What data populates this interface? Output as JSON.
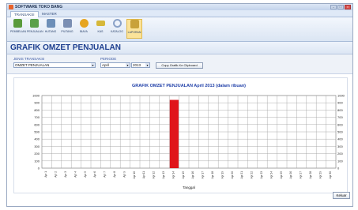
{
  "window": {
    "title": "SOFTWARE TOKO BANG"
  },
  "ribbon_tabs": [
    {
      "label": "TRANSAKSI",
      "active": true
    },
    {
      "label": "MASTER",
      "active": false
    }
  ],
  "ribbon_buttons": [
    {
      "label": "PEMBELIAN",
      "icon": "cart-icon",
      "color": "#5a9b3c"
    },
    {
      "label": "PENJUALAN",
      "icon": "money-icon",
      "color": "#5aa04a"
    },
    {
      "label": "HUTANG",
      "icon": "ledger-icon",
      "color": "#6d8fb8"
    },
    {
      "label": "PIUTANG",
      "icon": "notes-icon",
      "color": "#7b8fb3"
    },
    {
      "label": "BIAYA",
      "icon": "coin-icon",
      "color": "#e6a521"
    },
    {
      "label": "KAS",
      "icon": "cash-icon",
      "color": "#d6b83a"
    },
    {
      "label": "KATALOG",
      "icon": "magnifier-icon",
      "color": "#8aa2c8"
    },
    {
      "label": "LAPORAN",
      "icon": "report-icon",
      "color": "#c9a23a",
      "active": true
    }
  ],
  "page": {
    "title": "GRAFIK OMZET PENJUALAN"
  },
  "filters": {
    "jenis_label": "JENIS TRANSAKSI",
    "jenis_value": "OMZET PENJUALAN",
    "periode_label": "PERIODE",
    "bulan_value": "April",
    "tahun_value": "2013",
    "copy_button": "Copy Grafik Ke Clipboard"
  },
  "chart_data": {
    "type": "bar",
    "title": "GRAFIK OMZET PENJUALAN April 2013 (dalam ribuan)",
    "xlabel": "Tanggal",
    "ylabel": "",
    "ylim": [
      0,
      1000
    ],
    "yticks": [
      0,
      100,
      200,
      300,
      400,
      500,
      600,
      700,
      800,
      900,
      1000
    ],
    "categories": [
      "Apr 1",
      "Apr 2",
      "Apr 3",
      "Apr 4",
      "Apr 5",
      "Apr 6",
      "Apr 7",
      "Apr 8",
      "Apr 9",
      "Apr 10",
      "Apr 11",
      "Apr 12",
      "Apr 13",
      "Apr 14",
      "Apr 15",
      "Apr 16",
      "Apr 17",
      "Apr 18",
      "Apr 19",
      "Apr 20",
      "Apr 21",
      "Apr 22",
      "Apr 23",
      "Apr 24",
      "Apr 25",
      "Apr 26",
      "Apr 27",
      "Apr 28",
      "Apr 29",
      "Apr 30"
    ],
    "values": [
      0,
      0,
      0,
      0,
      0,
      0,
      0,
      0,
      0,
      0,
      0,
      0,
      0,
      940,
      0,
      0,
      0,
      0,
      0,
      0,
      0,
      0,
      0,
      0,
      0,
      0,
      0,
      0,
      0,
      0
    ],
    "grid": true,
    "bar_color": "#e0151b"
  },
  "footer": {
    "close_button": "Keluar"
  }
}
